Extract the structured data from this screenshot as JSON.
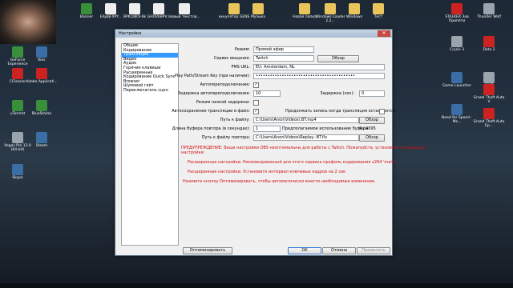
{
  "desktop": {
    "icons": [
      {
        "label": "GeForce Experience"
      },
      {
        "label": "CCleaner"
      },
      {
        "label": "uTorrent"
      },
      {
        "label": "Vegas Pro 13.0 (64-bit)"
      },
      {
        "label": "Skype"
      },
      {
        "label": "Kies"
      },
      {
        "label": "Adobe Applicati..."
      },
      {
        "label": "BlueStacks"
      },
      {
        "label": "Steam"
      },
      {
        "label": "Banner"
      },
      {
        "label": "EAy8jFXPY..."
      },
      {
        "label": "BPKcz8Ol-6k"
      },
      {
        "label": "GHDVb8PV..."
      },
      {
        "label": "Новый текстов..."
      },
      {
        "label": "аккулятор GENS"
      },
      {
        "label": "Музыка"
      },
      {
        "label": "Новая папка"
      },
      {
        "label": "Windows Loader 2.2..."
      },
      {
        "label": "Windows"
      },
      {
        "label": "Тест"
      },
      {
        "label": "STALKER Зов Припяти"
      },
      {
        "label": "Thunder Wolf"
      },
      {
        "label": "Crysis 3"
      },
      {
        "label": "Dota 2"
      },
      {
        "label": "Game Launcher"
      },
      {
        "label": "WoT"
      },
      {
        "label": "Need for Speed - Mo..."
      },
      {
        "label": "Grand Theft Auto V"
      },
      {
        "label": "Grand Theft Auto Ep..."
      }
    ]
  },
  "window": {
    "title": "Настройки",
    "sidebar": [
      "Общие",
      "Кодирование",
      "Трансляция",
      "Видео",
      "Аудио",
      "Горячие клавиши",
      "Расширенные",
      "Кодирование Quick Sync",
      "Browser",
      "Шумовой гейт",
      "Переключатель сцен"
    ],
    "selected_index": 2,
    "form": {
      "mode_label": "Режим:",
      "mode_value": "Прямой эфир",
      "service_label": "Сервис вещания:",
      "service_value": "Twitch",
      "browse1": "Обзор",
      "fms_label": "FMS URL:",
      "fms_value": "EU: Amsterdam, NL",
      "key_label": "Play Path/Stream Key (при наличии):",
      "key_value": "••••••••••••••••••••••••••••••••••••••••••",
      "autoreconnect_label": "Автопереподключение:",
      "delay_label": "Задержка автопереподключения:",
      "delay_value": "10",
      "lat_label": "Задержка (сек):",
      "lat_value": "0",
      "lowlat_label": "Режим низкой задержки:",
      "save_label": "Автосохранение трансляции в файл:",
      "keep_label": "Продолжать запись когда трансляция остановится:",
      "path_label": "Путь к файлу:",
      "path_value": "C:\\Users\\Anon\\Videos\\.BT.mp4",
      "browse2": "Обзор",
      "buffer_label": "Длина буфера повтора (в секундах):",
      "buffer_value": "1",
      "mem_label": "Предполагаемое использование буфера",
      "mem_value": "4 / 4095",
      "replay_label": "Путь к файлу повтора:",
      "replay_value": "C:\\Users\\Anon\\Videos\\Replay-.BT.flv",
      "browse3": "Обзор"
    },
    "warnings": [
      "ПРЕДУПРЕЖДЕНИЕ: Ваши настройки OBS неоптимальны для работы с Twitch. Пожалуйста, установите следующие",
      "настройки:",
      "Расширенные настройки: Рекомендованный для этого сервиса профиль кодирования x264 'main'",
      "Расширенные настройки: Установите интервал ключевых кадров на 2 сек",
      "Нажмите кнопку Оптимизировать, чтобы автоматически внести необходимые изменения."
    ],
    "buttons": {
      "optimize": "Оптимизировать",
      "ok": "OK",
      "cancel": "Отмена",
      "apply": "Применить"
    }
  }
}
